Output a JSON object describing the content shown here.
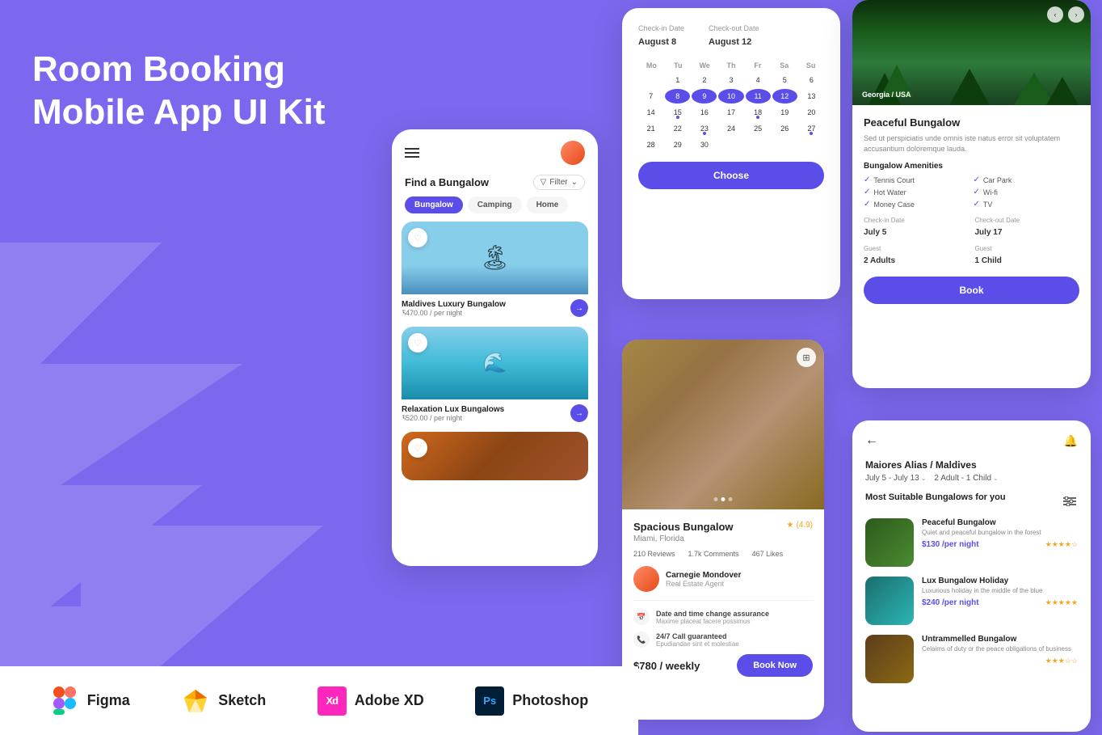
{
  "hero": {
    "title_line1": "Room Booking",
    "title_line2": "Mobile App UI Kit"
  },
  "footer": {
    "tools": [
      {
        "name": "Figma",
        "icon_label": "F",
        "icon_color": "#FF7262",
        "id": "figma"
      },
      {
        "name": "Sketch",
        "icon_label": "S",
        "icon_color": "#F7AB1B",
        "id": "sketch"
      },
      {
        "name": "Adobe XD",
        "icon_label": "Xd",
        "icon_color": "#FF26BE",
        "id": "xd"
      },
      {
        "name": "Photoshop",
        "icon_label": "Ps",
        "icon_color": "#001E36",
        "id": "ps"
      }
    ]
  },
  "screen1": {
    "find_label": "Find a Bungalow",
    "filter_label": "Filter",
    "tabs": [
      "Bungalow",
      "Camping",
      "Home"
    ],
    "active_tab": 0,
    "listings": [
      {
        "name": "Maldives Luxury Bungalow",
        "price": "$470.00 / per night"
      },
      {
        "name": "Relaxation Lux Bungalows",
        "price": "$520.00 / per night"
      }
    ]
  },
  "screen2": {
    "checkin_label": "Check-in Date",
    "checkout_label": "Check-out Date",
    "checkin_value": "August 8",
    "checkout_value": "August 12",
    "days": [
      "Mo",
      "Tu",
      "We",
      "Th",
      "Fr",
      "Sa",
      "Su"
    ],
    "choose_btn": "Choose"
  },
  "screen3": {
    "location": "Georgia / USA",
    "title": "Peaceful Bungalow",
    "description": "Sed ut perspiciatis unde omnis iste natus error sit voluptatem accusantium doloremque lauda.",
    "amenities_title": "Bungalow Amenities",
    "amenities": [
      "Tennis Court",
      "Car Park",
      "Hot Water",
      "Wi-fi",
      "Money Case",
      "TV"
    ],
    "checkin_label": "Check-in Date",
    "checkout_label": "Check-out Date",
    "checkin_value": "July 5",
    "checkout_value": "July 17",
    "guest_label": "Guest",
    "guest_label2": "Guest",
    "guest_value1": "2 Adults",
    "guest_value2": "1 Child",
    "book_btn": "Book"
  },
  "screen4": {
    "title": "Spacious Bungalow",
    "location": "Miami, Florida",
    "rating": "(4.9)",
    "reviews": "210 Reviews",
    "comments": "1.7k Comments",
    "likes": "467 Likes",
    "agent_name": "Carnegie Mondover",
    "agent_role": "Real Estate Agent",
    "feature1": "Date and time change assurance",
    "feature1_sub": "Maxime placeat facere possimus",
    "feature2": "24/7 Call guaranteed",
    "feature2_sub": "Epudiandae sint et molestiae",
    "price": "$780 / weekly",
    "book_now": "Book Now"
  },
  "screen5": {
    "location_title": "Maiores Alias / Maldives",
    "date_filter": "July 5 - July 13",
    "guest_filter": "2 Adult - 1 Child",
    "section_title": "Most Suitable Bungalows for you",
    "recommendations": [
      {
        "name": "Peaceful Bungalow",
        "desc": "Quiet and peaceful bungalow in the forest",
        "price": "$130 /per night",
        "stars": 4
      },
      {
        "name": "Lux Bungalow Holiday",
        "desc": "Luxurious holiday in the middle of the blue",
        "price": "$240 /per night",
        "stars": 5
      },
      {
        "name": "Untrammelled Bungalow",
        "desc": "Celaims of duty or the peace obligations of business",
        "price": "",
        "stars": 3
      }
    ]
  }
}
